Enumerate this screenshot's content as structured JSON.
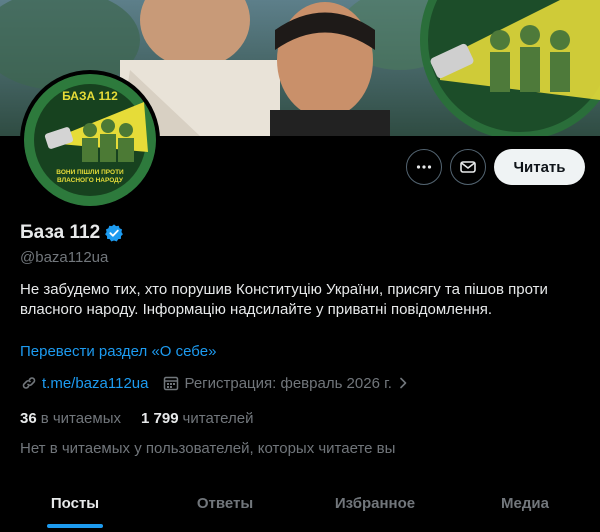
{
  "profile": {
    "name": "База 112",
    "handle": "@baza112ua",
    "verified": true,
    "bio": "Не забудемо тих, хто порушив Конституцію України, присягу та пішов проти власного народу. Інформацію надсилайте у приватні повідомлення.",
    "translate_label": "Перевести раздел «О себе»",
    "link": "t.me/baza112ua",
    "joined": "Регистрация: февраль 2026 г.",
    "following_count": "36",
    "following_label": "в читаемых",
    "followers_count": "1 799",
    "followers_label": "читателей",
    "not_followed_note": "Нет в читаемых у пользователей, которых читаете вы"
  },
  "avatar": {
    "top_text": "БАЗА 112",
    "bottom_text_1": "ВОНИ ПІШЛИ ПРОТИ",
    "bottom_text_2": "ВЛАСНОГО НАРОДУ"
  },
  "actions": {
    "more_icon": "more-icon",
    "message_icon": "envelope-icon",
    "follow_label": "Читать"
  },
  "tabs": [
    {
      "label": "Посты",
      "active": true
    },
    {
      "label": "Ответы",
      "active": false
    },
    {
      "label": "Избранное",
      "active": false
    },
    {
      "label": "Медиа",
      "active": false
    }
  ],
  "colors": {
    "accent": "#1d9bf0",
    "background": "#000000",
    "secondary_text": "#71767b",
    "primary_text": "#e7e9ea"
  }
}
